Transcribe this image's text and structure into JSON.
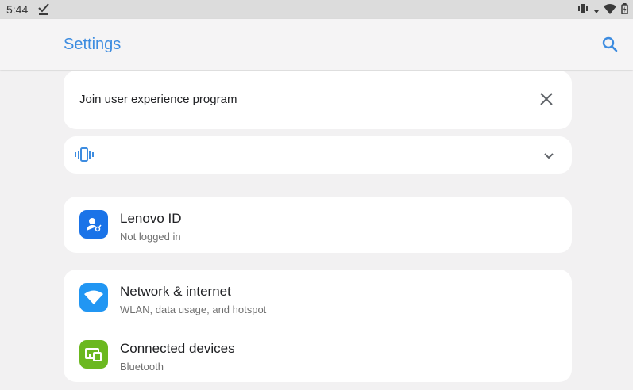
{
  "status_bar": {
    "time": "5:44"
  },
  "app_bar": {
    "title": "Settings"
  },
  "join_card": {
    "text": "Join user experience program"
  },
  "lenovo_id": {
    "title": "Lenovo ID",
    "subtitle": "Not logged in"
  },
  "settings_items": [
    {
      "title": "Network & internet",
      "subtitle": "WLAN, data usage, and hotspot",
      "icon": "wifi-icon"
    },
    {
      "title": "Connected devices",
      "subtitle": "Bluetooth",
      "icon": "connected-devices-icon"
    }
  ],
  "colors": {
    "accent": "#3d8ce0",
    "lenovo_icon_bg": "#1a73e8",
    "network_icon_bg": "#2196f3",
    "devices_icon_bg": "#6bb81f"
  }
}
